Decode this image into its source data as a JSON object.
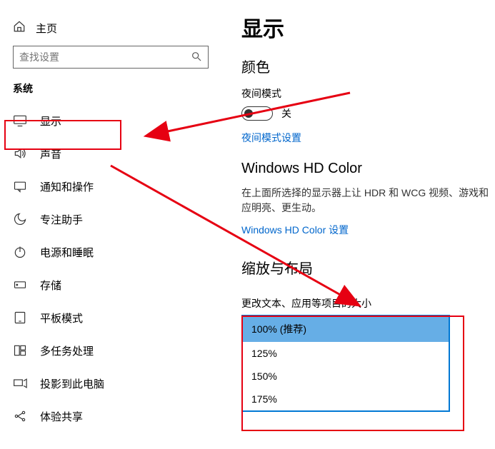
{
  "sidebar": {
    "home_label": "主页",
    "search_placeholder": "查找设置",
    "category_label": "系统",
    "items": [
      {
        "label": "显示"
      },
      {
        "label": "声音"
      },
      {
        "label": "通知和操作"
      },
      {
        "label": "专注助手"
      },
      {
        "label": "电源和睡眠"
      },
      {
        "label": "存储"
      },
      {
        "label": "平板模式"
      },
      {
        "label": "多任务处理"
      },
      {
        "label": "投影到此电脑"
      },
      {
        "label": "体验共享"
      }
    ]
  },
  "main": {
    "title": "显示",
    "color_section": "颜色",
    "night_mode_label": "夜间模式",
    "toggle_off_label": "关",
    "night_mode_settings_link": "夜间模式设置",
    "hd_section": "Windows HD Color",
    "hd_desc": "在上面所选择的显示器上让 HDR 和 WCG 视频、游戏和应明亮、更生动。",
    "hd_link": "Windows HD Color 设置",
    "scale_section": "缩放与布局",
    "scale_label": "更改文本、应用等项目的大小",
    "scale_options": [
      "100% (推荐)",
      "125%",
      "150%",
      "175%"
    ]
  }
}
